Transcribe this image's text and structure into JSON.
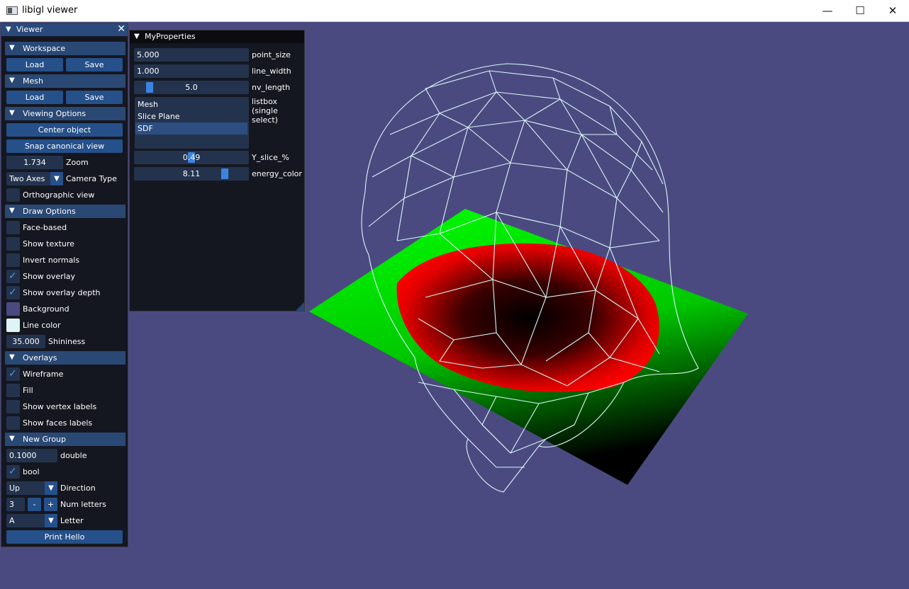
{
  "window": {
    "title": "libigl viewer",
    "minimize": "—",
    "maximize": "☐",
    "close": "✕"
  },
  "viewer": {
    "title": "Viewer",
    "workspace": {
      "header": "Workspace",
      "load": "Load",
      "save": "Save"
    },
    "mesh": {
      "header": "Mesh",
      "load": "Load",
      "save": "Save"
    },
    "viewing": {
      "header": "Viewing Options",
      "center": "Center object",
      "snap": "Snap canonical view",
      "zoom_value": "1.734",
      "zoom_label": "Zoom",
      "camera_value": "Two Axes",
      "camera_label": "Camera Type",
      "ortho_label": "Orthographic view"
    },
    "draw": {
      "header": "Draw Options",
      "face_based": "Face-based",
      "show_texture": "Show texture",
      "invert_normals": "Invert normals",
      "show_overlay": "Show overlay",
      "show_overlay_depth": "Show overlay depth",
      "background": "Background",
      "line_color": "Line color",
      "shininess_value": "35.000",
      "shininess_label": "Shininess"
    },
    "overlays": {
      "header": "Overlays",
      "wireframe": "Wireframe",
      "fill": "Fill",
      "vertex_labels": "Show vertex labels",
      "face_labels": "Show faces labels"
    },
    "group": {
      "header": "New Group",
      "double_value": "0.1000",
      "double_label": "double",
      "bool_label": "bool",
      "direction_value": "Up",
      "direction_label": "Direction",
      "num_value": "3",
      "minus": "-",
      "plus": "+",
      "num_label": "Num letters",
      "letter_value": "A",
      "letter_label": "Letter",
      "print": "Print Hello"
    }
  },
  "props": {
    "title": "MyProperties",
    "point_size_value": "5.000",
    "point_size_label": "point_size",
    "line_width_value": "1.000",
    "line_width_label": "line_width",
    "nv_length_value": "5.0",
    "nv_length_label": "nv_length",
    "listbox_items": [
      "Mesh",
      "Slice Plane",
      "SDF"
    ],
    "listbox_label_1": "listbox",
    "listbox_label_2": "(single select)",
    "y_slice_value": "0.49",
    "y_slice_label": "Y_slice_%",
    "energy_value": "8.11",
    "energy_label": "energy_color"
  },
  "colors": {
    "viewport_bg": "#4b4a80",
    "accent": "#3d84e0",
    "background_swatch": "#4b4a80",
    "line_color_swatch": "#dff5f5"
  }
}
